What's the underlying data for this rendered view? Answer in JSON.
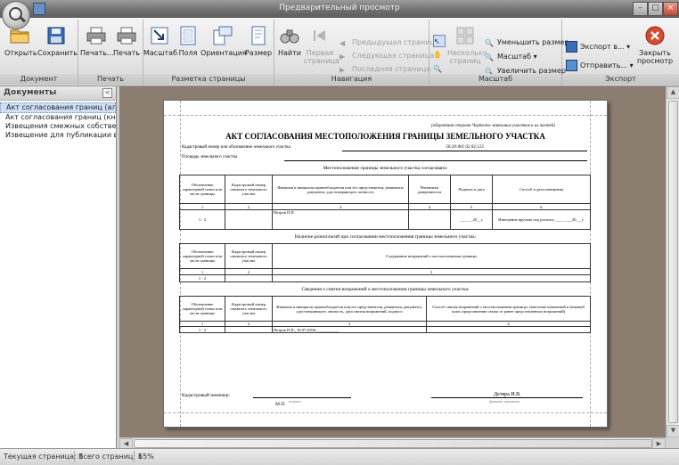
{
  "window": {
    "title": "Предварительный просмотр"
  },
  "ribbon": {
    "groups": {
      "document": "Документ",
      "print": "Печать",
      "layout": "Разметка страницы",
      "navigation": "Навигация",
      "zoom": "Масштаб",
      "export": "Экспорт"
    },
    "buttons": {
      "open": "Открыть",
      "save": "Сохранить",
      "print_dialog": "Печать...",
      "print": "Печать",
      "scale": "Масштаб",
      "margins": "Поля",
      "orientation": "Ориентация",
      "size": "Размер",
      "find": "Найти",
      "first_page_1": "Первая",
      "first_page_2": "страница",
      "prev_page": "Предыдущая страница",
      "next_page": "Следующая страница",
      "last_page": "Последняя страница",
      "multi_page_1": "Несколько",
      "multi_page_2": "страниц",
      "zoom_out": "Уменьшить размер",
      "zoom": "Масштаб",
      "zoom_in": "Увеличить размер",
      "export": "Экспорт в...",
      "send": "Отправить...",
      "close_1": "Закрыть",
      "close_2": "просмотр"
    }
  },
  "documents": {
    "header": "Документы",
    "items": [
      "Акт согласования границ (алб...",
      "Акт согласования границ (кни...",
      "Извещения смежных собствен...",
      "Извещение для публикации в ..."
    ]
  },
  "page": {
    "note": "(оборотная сторона Чертежа земельных участков и их частей)",
    "title": "АКТ СОГЛАСОВАНИЯ МЕСТОПОЛОЖЕНИЯ ГРАНИЦЫ ЗЕМЕЛЬНОГО УЧАСТКА",
    "cadnum_label": "Кадастровый номер или обозначение земельного участка",
    "cadnum_value": "50:20:001 02 03:123",
    "area_label": "Площадь земельного участка",
    "sec1": "Местоположение границы земельного участка согласовано:",
    "sec2": "Наличие разногласий при согласовании местоположения границы земельного участка:",
    "sec3": "Сведения о снятии возражений о местоположении границы земельного участка:",
    "t1_headers": [
      "Обозначение характерной точки или части границы",
      "Кадастровый номер смежного земельного участка",
      "Фамилия и инициалы правообладателя или его представителя, реквизиты документа, удостоверяющего личность",
      "Реквизиты доверенности",
      "Подпись и дата",
      "Способ и дата извещения"
    ],
    "t1_nums": [
      "1",
      "2",
      "3",
      "4",
      "5",
      "6"
    ],
    "t1_row": {
      "point": "1 - 2",
      "name": "Петров П.П.",
      "sign": "____ __20__г.",
      "method": "Извещение вручено под роспись ____ ____20___г."
    },
    "t2_headers": [
      "Обозначение характерной точки или части границы",
      "Кадастровый номер смежного земельного участка",
      "Содержание возражений о местоположении границы"
    ],
    "t2_nums": [
      "1",
      "2",
      "3"
    ],
    "t2_row": {
      "point": "1 - 2"
    },
    "t3_headers": [
      "Обозначение характерной точки или части границы",
      "Кадастровый номер смежного земельного участка",
      "Фамилия и инициалы правообладателя или его представителя, реквизиты документа, удостоверяющего личность, дата снятия возражений, подпись",
      "Способ снятия возражений о местоположении границы: (внесение изменений в межевой план, представление отказа от ранее представленных возражений)"
    ],
    "t3_nums": [
      "1",
      "2",
      "3",
      "4"
    ],
    "t3_row": {
      "point": "1 - 2",
      "name": "Петров П.П., 10.07.2010г., __________"
    },
    "engineer_label": "Кадастровый инженер:",
    "engineer_name": "Детяра И.В.",
    "mp": "М.П.",
    "sign_caption": "подпись",
    "name_caption": "фамилия, инициалы"
  },
  "status": {
    "current_page": "Текущая страница: 1",
    "total_pages": "Всего страниц: 1",
    "zoom": "65%"
  }
}
